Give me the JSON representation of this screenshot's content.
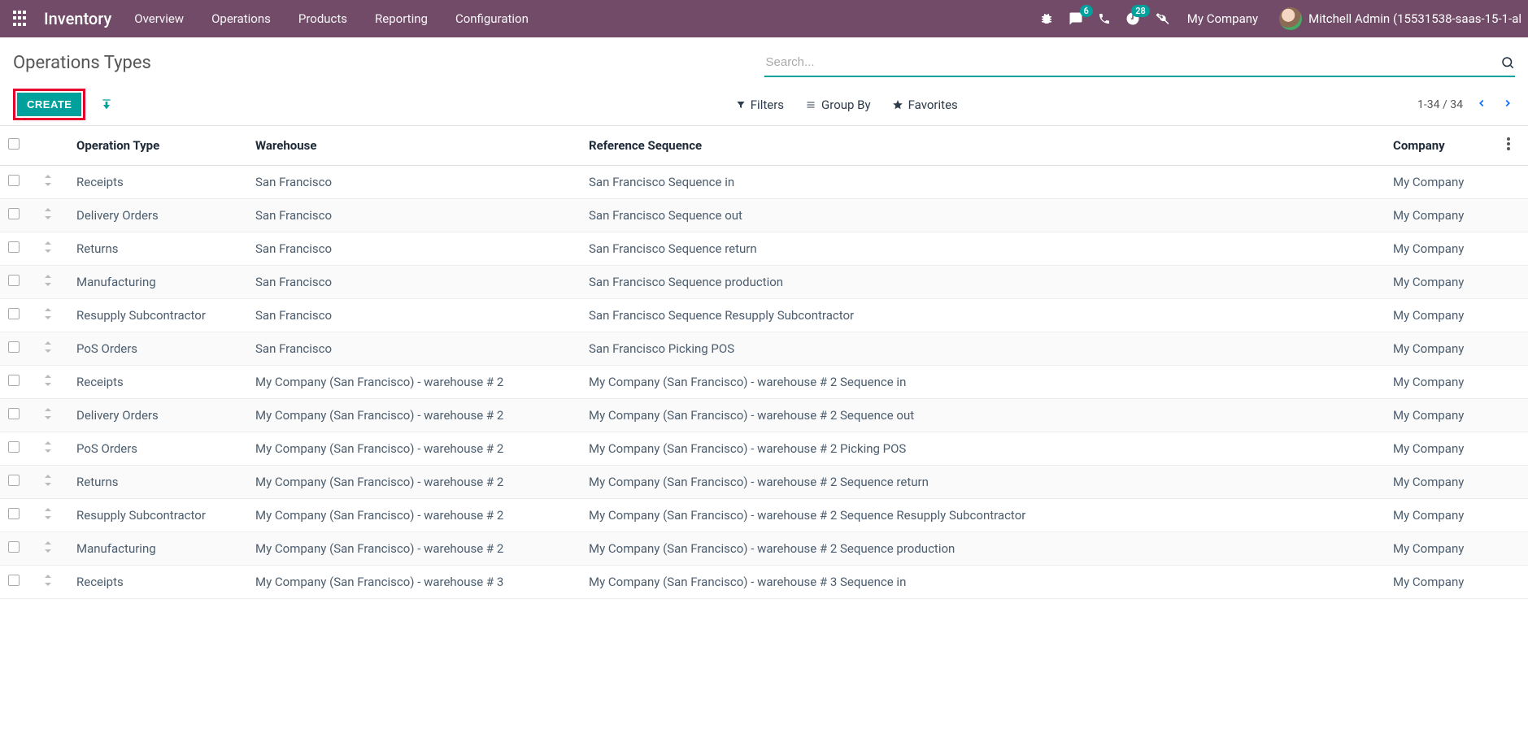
{
  "navbar": {
    "brand": "Inventory",
    "menu": [
      "Overview",
      "Operations",
      "Products",
      "Reporting",
      "Configuration"
    ],
    "chat_badge": "6",
    "activity_badge": "28",
    "company": "My Company",
    "user": "Mitchell Admin (15531538-saas-15-1-al"
  },
  "control": {
    "title": "Operations Types",
    "search_placeholder": "Search...",
    "create": "CREATE",
    "filters": "Filters",
    "group_by": "Group By",
    "favorites": "Favorites",
    "pager": "1-34 / 34"
  },
  "columns": {
    "op": "Operation Type",
    "wh": "Warehouse",
    "seq": "Reference Sequence",
    "comp": "Company"
  },
  "rows": [
    {
      "op": "Receipts",
      "wh": "San Francisco",
      "seq": "San Francisco Sequence in",
      "comp": "My Company"
    },
    {
      "op": "Delivery Orders",
      "wh": "San Francisco",
      "seq": "San Francisco Sequence out",
      "comp": "My Company"
    },
    {
      "op": "Returns",
      "wh": "San Francisco",
      "seq": "San Francisco Sequence return",
      "comp": "My Company"
    },
    {
      "op": "Manufacturing",
      "wh": "San Francisco",
      "seq": "San Francisco Sequence production",
      "comp": "My Company"
    },
    {
      "op": "Resupply Subcontractor",
      "wh": "San Francisco",
      "seq": "San Francisco Sequence Resupply Subcontractor",
      "comp": "My Company"
    },
    {
      "op": "PoS Orders",
      "wh": "San Francisco",
      "seq": "San Francisco Picking POS",
      "comp": "My Company"
    },
    {
      "op": "Receipts",
      "wh": "My Company (San Francisco) - warehouse # 2",
      "seq": "My Company (San Francisco) - warehouse # 2 Sequence in",
      "comp": "My Company"
    },
    {
      "op": "Delivery Orders",
      "wh": "My Company (San Francisco) - warehouse # 2",
      "seq": "My Company (San Francisco) - warehouse # 2 Sequence out",
      "comp": "My Company"
    },
    {
      "op": "PoS Orders",
      "wh": "My Company (San Francisco) - warehouse # 2",
      "seq": "My Company (San Francisco) - warehouse # 2 Picking POS",
      "comp": "My Company"
    },
    {
      "op": "Returns",
      "wh": "My Company (San Francisco) - warehouse # 2",
      "seq": "My Company (San Francisco) - warehouse # 2 Sequence return",
      "comp": "My Company"
    },
    {
      "op": "Resupply Subcontractor",
      "wh": "My Company (San Francisco) - warehouse # 2",
      "seq": "My Company (San Francisco) - warehouse # 2 Sequence Resupply Subcontractor",
      "comp": "My Company"
    },
    {
      "op": "Manufacturing",
      "wh": "My Company (San Francisco) - warehouse # 2",
      "seq": "My Company (San Francisco) - warehouse # 2 Sequence production",
      "comp": "My Company"
    },
    {
      "op": "Receipts",
      "wh": "My Company (San Francisco) - warehouse # 3",
      "seq": "My Company (San Francisco) - warehouse # 3 Sequence in",
      "comp": "My Company"
    }
  ]
}
